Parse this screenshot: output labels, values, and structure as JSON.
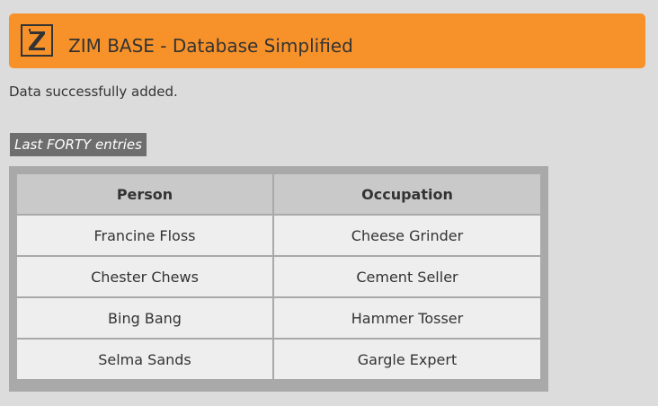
{
  "header": {
    "logo_letter": "Z",
    "title": "ZIM BASE - Database Simplified",
    "accent_color": "#f7922a"
  },
  "status_message": "Data successfully added.",
  "section": {
    "label": "Last FORTY entries"
  },
  "table": {
    "columns": [
      "Person",
      "Occupation"
    ],
    "rows": [
      {
        "person": "Francine Floss",
        "occupation": "Cheese Grinder"
      },
      {
        "person": "Chester Chews",
        "occupation": "Cement Seller"
      },
      {
        "person": "Bing Bang",
        "occupation": "Hammer Tosser"
      },
      {
        "person": "Selma Sands",
        "occupation": "Gargle Expert"
      }
    ]
  }
}
